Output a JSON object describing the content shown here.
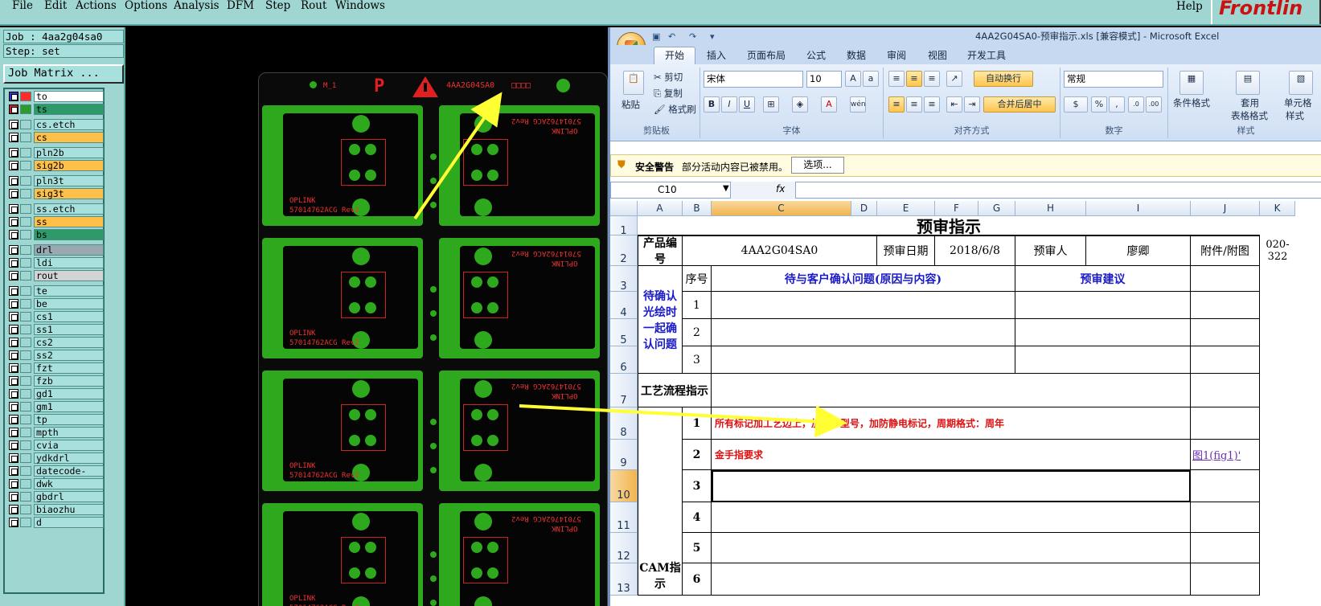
{
  "cam": {
    "menu": [
      "File",
      "Edit",
      "Actions",
      "Options",
      "Analysis",
      "DFM",
      "Step",
      "Rout",
      "Windows"
    ],
    "help": "Help",
    "logo": "Frontlin",
    "job": "Job : 4aa2g04sa0",
    "step": "Step: set",
    "job_matrix": "Job Matrix ...",
    "layers": [
      {
        "name": "to",
        "color": "#ff2a2a",
        "fill": "#ffffff",
        "marker": "#3333cc"
      },
      {
        "name": "ts",
        "color": "#2e9a2e",
        "fill": "#2e9a6a",
        "marker": "#cc2222"
      },
      {
        "name": "cs.etch",
        "color": "",
        "fill": "#a7e0dc"
      },
      {
        "name": "cs",
        "color": "",
        "fill": "#ffc04a"
      },
      {
        "name": "pln2b",
        "color": "",
        "fill": "#a7e0dc"
      },
      {
        "name": "sig2b",
        "color": "",
        "fill": "#ffc04a"
      },
      {
        "name": "pln3t",
        "color": "",
        "fill": "#a7e0dc"
      },
      {
        "name": "sig3t",
        "color": "",
        "fill": "#ffc04a"
      },
      {
        "name": "ss.etch",
        "color": "",
        "fill": "#a7e0dc"
      },
      {
        "name": "ss",
        "color": "",
        "fill": "#ffc04a"
      },
      {
        "name": "bs",
        "color": "",
        "fill": "#2e9a6a"
      },
      {
        "name": "drl",
        "color": "",
        "fill": "#9aa9b1"
      },
      {
        "name": "ldi",
        "color": "",
        "fill": "#a7e0dc"
      },
      {
        "name": "rout",
        "color": "",
        "fill": "#d3d3d3"
      },
      {
        "name": "te",
        "color": "",
        "fill": "#a7e0dc"
      },
      {
        "name": "be",
        "color": "",
        "fill": "#a7e0dc"
      },
      {
        "name": "cs1",
        "color": "",
        "fill": "#a7e0dc"
      },
      {
        "name": "ss1",
        "color": "",
        "fill": "#a7e0dc"
      },
      {
        "name": "cs2",
        "color": "",
        "fill": "#a7e0dc"
      },
      {
        "name": "ss2",
        "color": "",
        "fill": "#a7e0dc"
      },
      {
        "name": "fzt",
        "color": "",
        "fill": "#a7e0dc"
      },
      {
        "name": "fzb",
        "color": "",
        "fill": "#a7e0dc"
      },
      {
        "name": "gd1",
        "color": "",
        "fill": "#a7e0dc"
      },
      {
        "name": "gm1",
        "color": "",
        "fill": "#a7e0dc"
      },
      {
        "name": "tp",
        "color": "",
        "fill": "#a7e0dc"
      },
      {
        "name": "mpth",
        "color": "",
        "fill": "#a7e0dc"
      },
      {
        "name": "cvia",
        "color": "",
        "fill": "#a7e0dc"
      },
      {
        "name": "ydkdrl",
        "color": "",
        "fill": "#a7e0dc"
      },
      {
        "name": "datecode-pto",
        "color": "",
        "fill": "#a7e0dc"
      },
      {
        "name": "dwk",
        "color": "",
        "fill": "#a7e0dc"
      },
      {
        "name": "gbdrl",
        "color": "",
        "fill": "#a7e0dc"
      },
      {
        "name": "biaozhu",
        "color": "",
        "fill": "#a7e0dc"
      },
      {
        "name": "d",
        "color": "",
        "fill": "#a7e0dc"
      }
    ],
    "board": {
      "header_m": "M_1",
      "header_id": "4AA2G04SA0",
      "pcb_name": "OPLINK",
      "pcb_part": "57014762ACG Rev2"
    }
  },
  "excel": {
    "title": "4AA2G04SA0-预审指示.xls  [兼容模式] - Microsoft Excel",
    "tabs": [
      "开始",
      "插入",
      "页面布局",
      "公式",
      "数据",
      "审阅",
      "视图",
      "开发工具"
    ],
    "clipboard": {
      "paste": "粘贴",
      "cut": "剪切",
      "copy": "复制",
      "format_painter": "格式刷",
      "label": "剪贴板"
    },
    "font": {
      "name": "宋体",
      "size": "10",
      "label": "字体",
      "bold": "B",
      "italic": "I",
      "underline": "U",
      "phonetic": "wén"
    },
    "align": {
      "wrap": "自动换行",
      "merge": "合并后居中",
      "label": "对齐方式"
    },
    "number": {
      "format": "常规",
      "label": "数字"
    },
    "styles": {
      "cond": "条件格式",
      "table": "套用",
      "table2": "表格格式",
      "cell": "单元格",
      "cell2": "样式",
      "label": "样式"
    },
    "security": {
      "title": "安全警告",
      "message": "部分活动内容已被禁用。",
      "options": "选项..."
    },
    "namebox": "C10",
    "fx": "fx",
    "columns": [
      "A",
      "B",
      "C",
      "D",
      "E",
      "F",
      "G",
      "H",
      "I",
      "J",
      "K"
    ],
    "rows": [
      "1",
      "2",
      "3",
      "4",
      "5",
      "6",
      "7",
      "8",
      "9",
      "10",
      "11",
      "12",
      "13"
    ],
    "sheet": {
      "title": "预审指示",
      "product_label": "产品编号",
      "product_value": "4AA2G04SA0",
      "date_label": "预审日期",
      "date_value": "2018/6/8",
      "reviewer_label": "预审人",
      "reviewer_value": "廖卿",
      "attach_label": "附件/附图",
      "k2": "020-322",
      "pending_label": "待确认光绘时一起确认问题",
      "seq": "序号",
      "customer_issue": "待与客户确认问题(原因与内容)",
      "suggestion": "预审建议",
      "issue_nums": [
        "1",
        "2",
        "3"
      ],
      "process_label": "工艺流程指示",
      "cam_label": "CAM指示",
      "cam_nums": [
        "1",
        "2",
        "3",
        "4",
        "5",
        "6"
      ],
      "cam_row1": "所有标记加工艺边上，加客户型号，加防静电标记，周期格式：周年",
      "cam_row2": "金手指要求",
      "cam_row2_link": "图1(fig1)'"
    }
  }
}
